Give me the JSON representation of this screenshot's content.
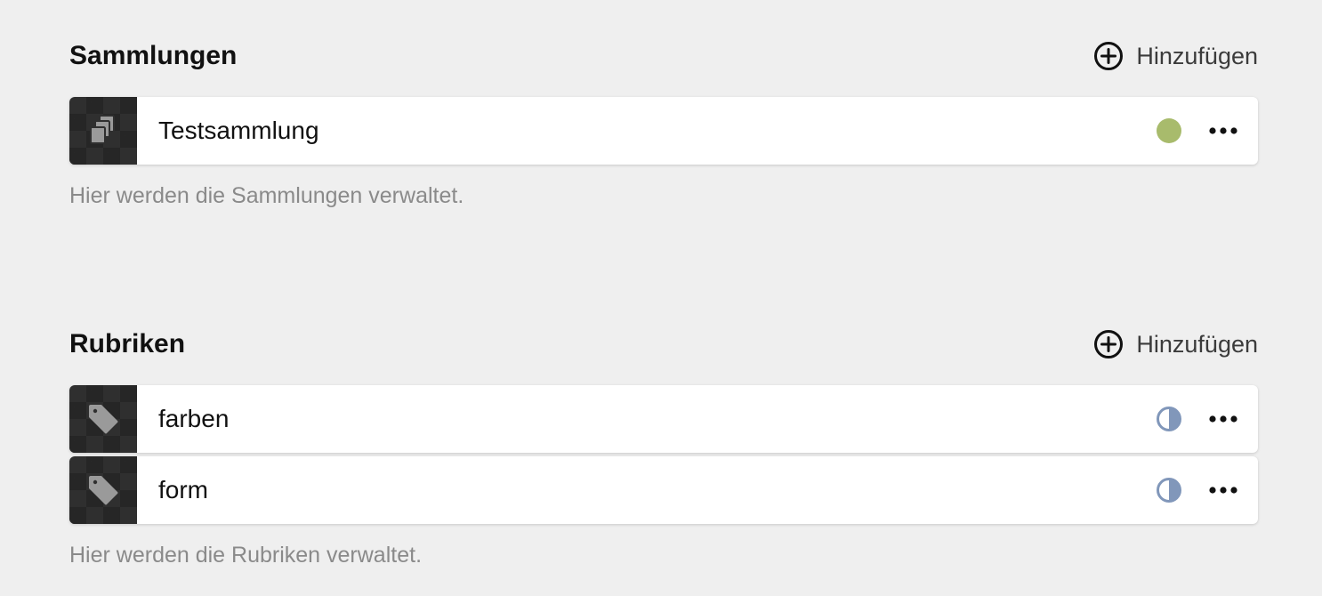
{
  "collections": {
    "title": "Sammlungen",
    "add_label": "Hinzufügen",
    "items": [
      {
        "label": "Testsammlung",
        "icon": "collection-icon",
        "status": "published",
        "status_color": "#a8bb6c"
      }
    ],
    "help": "Hier werden die Sammlungen verwaltet."
  },
  "rubrics": {
    "title": "Rubriken",
    "add_label": "Hinzufügen",
    "items": [
      {
        "label": "farben",
        "icon": "tag-icon",
        "status": "half",
        "status_color": "#8197ba"
      },
      {
        "label": "form",
        "icon": "tag-icon",
        "status": "half",
        "status_color": "#8197ba"
      }
    ],
    "help": "Hier werden die Rubriken verwaltet."
  },
  "colors": {
    "background": "#efefef",
    "thumb_dark": "#2f2f2f",
    "icon_gray": "#9a9a9a",
    "help_text": "#8a8a8a"
  }
}
